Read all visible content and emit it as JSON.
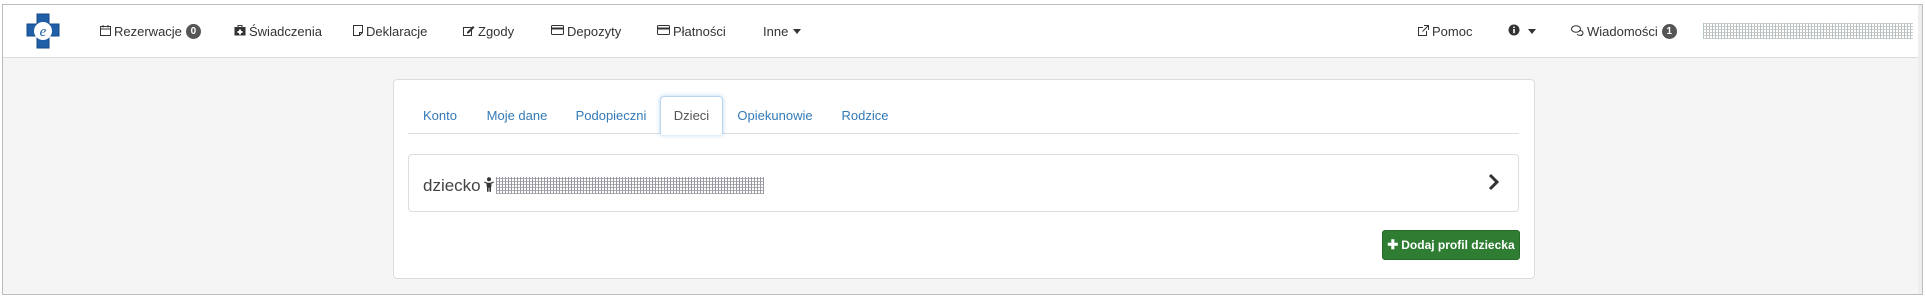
{
  "navbar": {
    "items": [
      {
        "label": "Rezerwacje",
        "icon": "calendar-icon",
        "badge": "0"
      },
      {
        "label": "Świadczenia",
        "icon": "medkit-icon"
      },
      {
        "label": "Deklaracje",
        "icon": "note-icon"
      },
      {
        "label": "Zgody",
        "icon": "edit-icon"
      },
      {
        "label": "Depozyty",
        "icon": "credit-card-icon"
      },
      {
        "label": "Płatności",
        "icon": "credit-card-icon"
      },
      {
        "label": "Inne",
        "icon": "caret-down-icon"
      }
    ],
    "right": {
      "help": {
        "label": "Pomoc",
        "icon": "external-link-icon"
      },
      "info": {
        "icon": "info-circle-icon"
      },
      "messages": {
        "label": "Wiadomości",
        "icon": "comments-icon",
        "badge": "1"
      }
    }
  },
  "tabs": [
    "Konto",
    "Moje dane",
    "Podopieczni",
    "Dzieci",
    "Opiekunowie",
    "Rodzice"
  ],
  "active_tab": "Dzieci",
  "child": {
    "label": "dziecko",
    "icon": "child-icon"
  },
  "add_button": {
    "label": "Dodaj profil dziecka",
    "icon": "plus-icon"
  },
  "colors": {
    "link": "#337ab7",
    "success": "#2e7d32",
    "badge": "#555555",
    "logo": "#1f5fa8"
  }
}
